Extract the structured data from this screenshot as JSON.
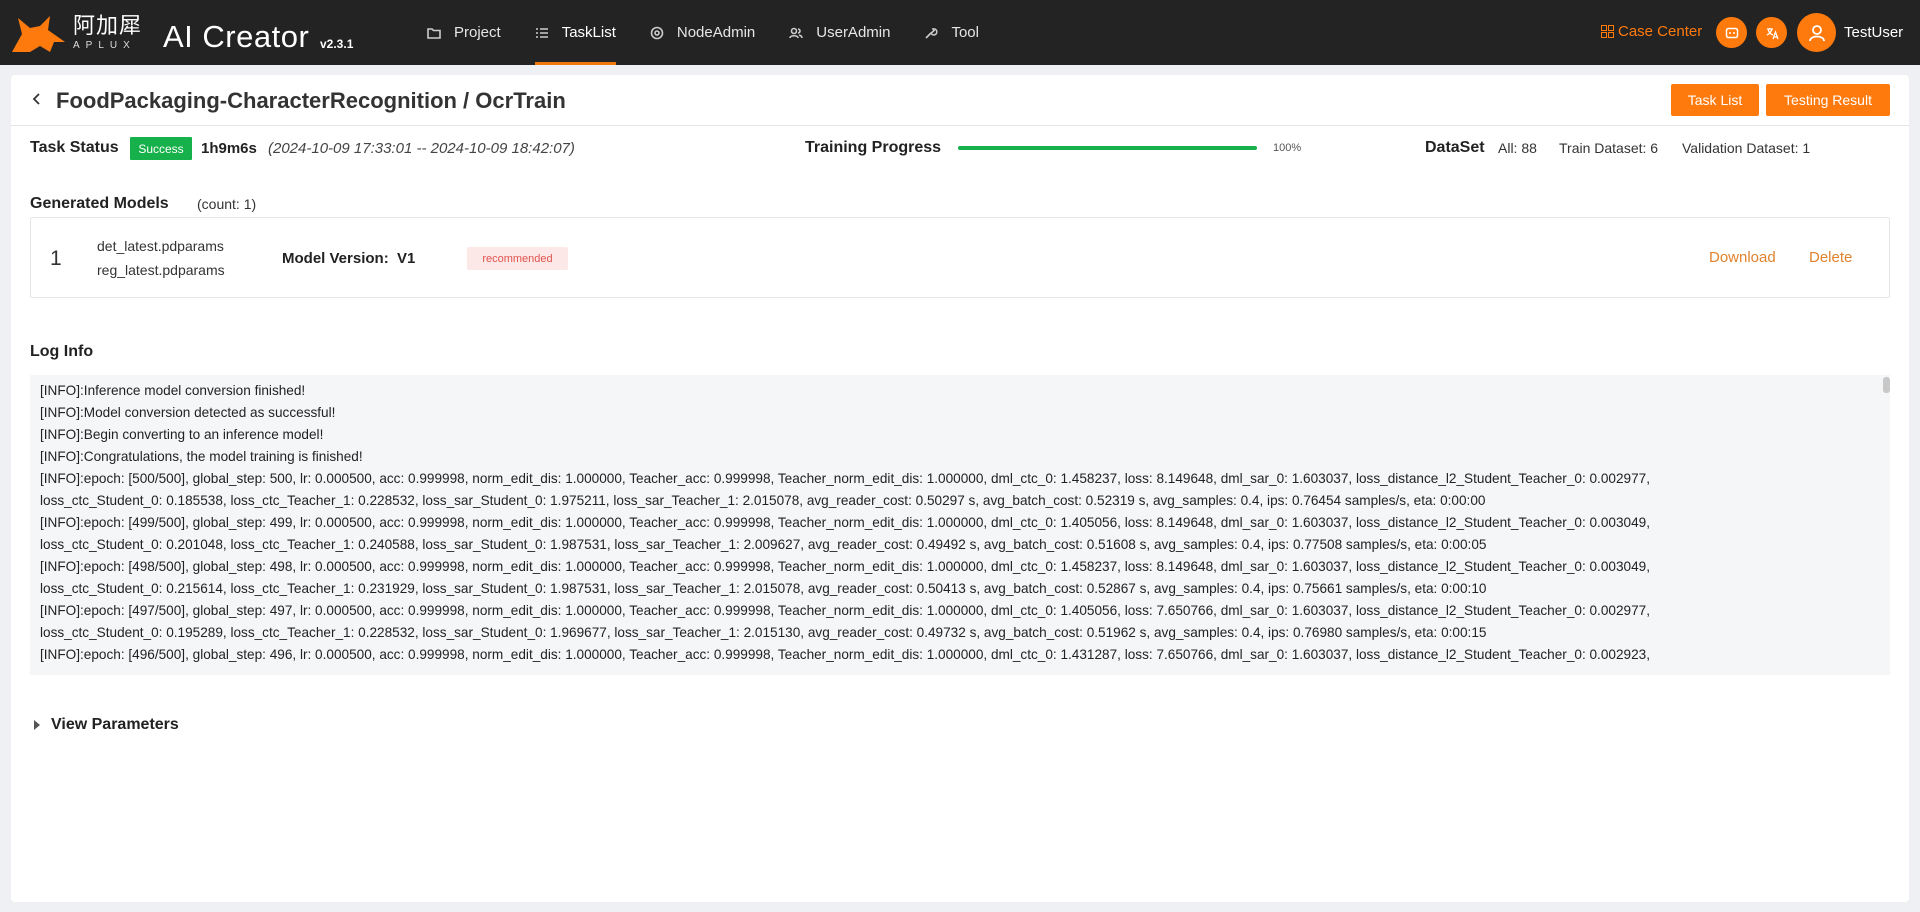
{
  "header": {
    "logo_cn": "阿加犀",
    "logo_en": "APLUX",
    "app_title": "AI Creator",
    "version": "v2.3.1",
    "nav": [
      {
        "label": "Project",
        "icon": "folder-icon"
      },
      {
        "label": "TaskList",
        "icon": "list-icon",
        "active": true
      },
      {
        "label": "NodeAdmin",
        "icon": "node-icon"
      },
      {
        "label": "UserAdmin",
        "icon": "users-icon"
      },
      {
        "label": "Tool",
        "icon": "wrench-icon"
      }
    ],
    "case_center": "Case Center",
    "username": "TestUser",
    "accent_color": "#ff7a0d"
  },
  "page": {
    "title": "FoodPackaging-CharacterRecognition / OcrTrain",
    "task_list_button": "Task List",
    "testing_result_button": "Testing Result"
  },
  "status": {
    "label": "Task Status",
    "badge": "Success",
    "badge_color": "#16b14a",
    "duration": "1h9m6s",
    "time_range": "(2024-10-09 17:33:01 -- 2024-10-09 18:42:07)",
    "progress_label": "Training Progress",
    "progress_value": 100,
    "progress_text": "100%",
    "dataset_label": "DataSet",
    "dataset_all": "All: 88",
    "dataset_train": "Train Dataset: 6",
    "dataset_validation": "Validation Dataset: 1"
  },
  "models": {
    "heading": "Generated Models",
    "count": "(count:  1)",
    "items": [
      {
        "index": "1",
        "file1": "det_latest.pdparams",
        "file2": "reg_latest.pdparams",
        "version_label": "Model Version:",
        "version": "V1",
        "badge": "recommended",
        "download": "Download",
        "delete": "Delete"
      }
    ]
  },
  "log": {
    "heading": "Log Info",
    "lines": [
      "[INFO]:Inference model conversion finished!",
      "[INFO]:Model conversion detected as successful!",
      "[INFO]:Begin converting to an inference model!",
      "[INFO]:Congratulations, the model training is finished!",
      "[INFO]:epoch: [500/500], global_step: 500, lr: 0.000500, acc: 0.999998, norm_edit_dis: 1.000000, Teacher_acc: 0.999998, Teacher_norm_edit_dis: 1.000000, dml_ctc_0: 1.458237, loss: 8.149648, dml_sar_0: 1.603037, loss_distance_l2_Student_Teacher_0: 0.002977,",
      "loss_ctc_Student_0: 0.185538, loss_ctc_Teacher_1: 0.228532, loss_sar_Student_0: 1.975211, loss_sar_Teacher_1: 2.015078, avg_reader_cost: 0.50297 s, avg_batch_cost: 0.52319 s, avg_samples: 0.4, ips: 0.76454 samples/s, eta: 0:00:00",
      "[INFO]:epoch: [499/500], global_step: 499, lr: 0.000500, acc: 0.999998, norm_edit_dis: 1.000000, Teacher_acc: 0.999998, Teacher_norm_edit_dis: 1.000000, dml_ctc_0: 1.405056, loss: 8.149648, dml_sar_0: 1.603037, loss_distance_l2_Student_Teacher_0: 0.003049,",
      "loss_ctc_Student_0: 0.201048, loss_ctc_Teacher_1: 0.240588, loss_sar_Student_0: 1.987531, loss_sar_Teacher_1: 2.009627, avg_reader_cost: 0.49492 s, avg_batch_cost: 0.51608 s, avg_samples: 0.4, ips: 0.77508 samples/s, eta: 0:00:05",
      "[INFO]:epoch: [498/500], global_step: 498, lr: 0.000500, acc: 0.999998, norm_edit_dis: 1.000000, Teacher_acc: 0.999998, Teacher_norm_edit_dis: 1.000000, dml_ctc_0: 1.458237, loss: 8.149648, dml_sar_0: 1.603037, loss_distance_l2_Student_Teacher_0: 0.003049,",
      "loss_ctc_Student_0: 0.215614, loss_ctc_Teacher_1: 0.231929, loss_sar_Student_0: 1.987531, loss_sar_Teacher_1: 2.015078, avg_reader_cost: 0.50413 s, avg_batch_cost: 0.52867 s, avg_samples: 0.4, ips: 0.75661 samples/s, eta: 0:00:10",
      "[INFO]:epoch: [497/500], global_step: 497, lr: 0.000500, acc: 0.999998, norm_edit_dis: 1.000000, Teacher_acc: 0.999998, Teacher_norm_edit_dis: 1.000000, dml_ctc_0: 1.405056, loss: 7.650766, dml_sar_0: 1.603037, loss_distance_l2_Student_Teacher_0: 0.002977,",
      "loss_ctc_Student_0: 0.195289, loss_ctc_Teacher_1: 0.228532, loss_sar_Student_0: 1.969677, loss_sar_Teacher_1: 2.015130, avg_reader_cost: 0.49732 s, avg_batch_cost: 0.51962 s, avg_samples: 0.4, ips: 0.76980 samples/s, eta: 0:00:15",
      "[INFO]:epoch: [496/500], global_step: 496, lr: 0.000500, acc: 0.999998, norm_edit_dis: 1.000000, Teacher_acc: 0.999998, Teacher_norm_edit_dis: 1.000000, dml_ctc_0: 1.431287, loss: 7.650766, dml_sar_0: 1.603037, loss_distance_l2_Student_Teacher_0: 0.002923,"
    ]
  },
  "params": {
    "label": "View Parameters"
  }
}
